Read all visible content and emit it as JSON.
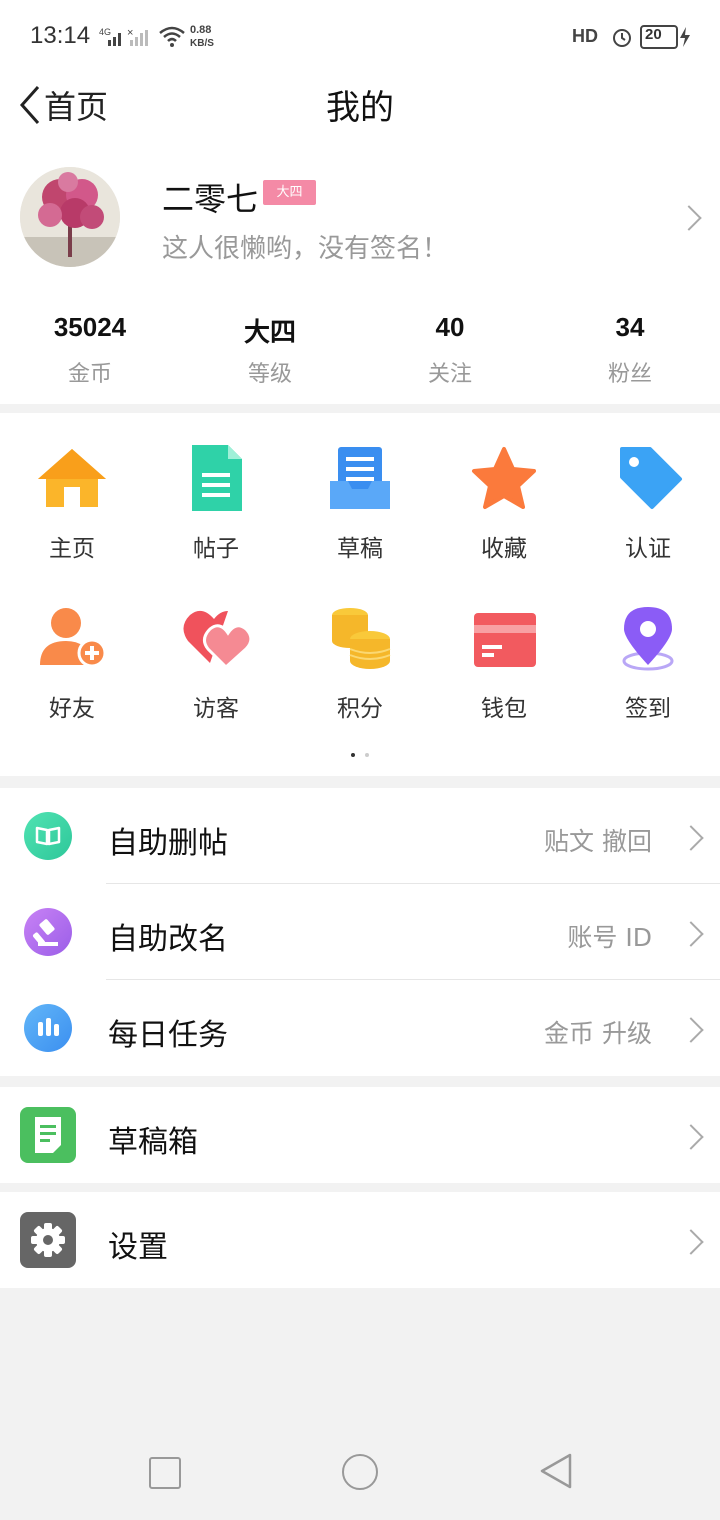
{
  "status_bar": {
    "time": "13:14",
    "net_type": "4G",
    "speed_value": "0.88",
    "speed_unit": "KB/S",
    "hd": "HD",
    "battery": "20"
  },
  "header": {
    "back_label": "首页",
    "title": "我的"
  },
  "profile": {
    "name": "二零七",
    "badge": "大四",
    "signature": "这人很懒哟，没有签名！"
  },
  "stats": [
    {
      "value": "35024",
      "label": "金币"
    },
    {
      "value": "大四",
      "label": "等级"
    },
    {
      "value": "40",
      "label": "关注"
    },
    {
      "value": "34",
      "label": "粉丝"
    }
  ],
  "grid": [
    {
      "label": "主页",
      "icon": "home-icon"
    },
    {
      "label": "帖子",
      "icon": "document-icon"
    },
    {
      "label": "草稿",
      "icon": "inbox-icon"
    },
    {
      "label": "收藏",
      "icon": "star-icon"
    },
    {
      "label": "认证",
      "icon": "tag-icon"
    },
    {
      "label": "好友",
      "icon": "add-friend-icon"
    },
    {
      "label": "访客",
      "icon": "hearts-icon"
    },
    {
      "label": "积分",
      "icon": "coins-icon"
    },
    {
      "label": "钱包",
      "icon": "wallet-icon"
    },
    {
      "label": "签到",
      "icon": "location-pin-icon"
    }
  ],
  "grid_page": {
    "current": 1,
    "total": 2
  },
  "tools": [
    {
      "label": "自助删帖",
      "right": "贴文  撤回",
      "icon": "book-icon",
      "color": "#3fd6a4"
    },
    {
      "label": "自助改名",
      "right": "账号  ID",
      "icon": "gavel-icon",
      "color": "#b46bf0"
    },
    {
      "label": "每日任务",
      "right": "金币  升级",
      "icon": "bar-chart-icon",
      "color": "#4aa3f5"
    }
  ],
  "drafts": {
    "label": "草稿箱",
    "icon": "note-icon",
    "color": "#4bbf5f"
  },
  "settings": {
    "label": "设置",
    "icon": "gear-icon",
    "color": "#666666"
  },
  "colors": {
    "accent_pink": "#f48aa6",
    "background": "#f2f2f2"
  }
}
